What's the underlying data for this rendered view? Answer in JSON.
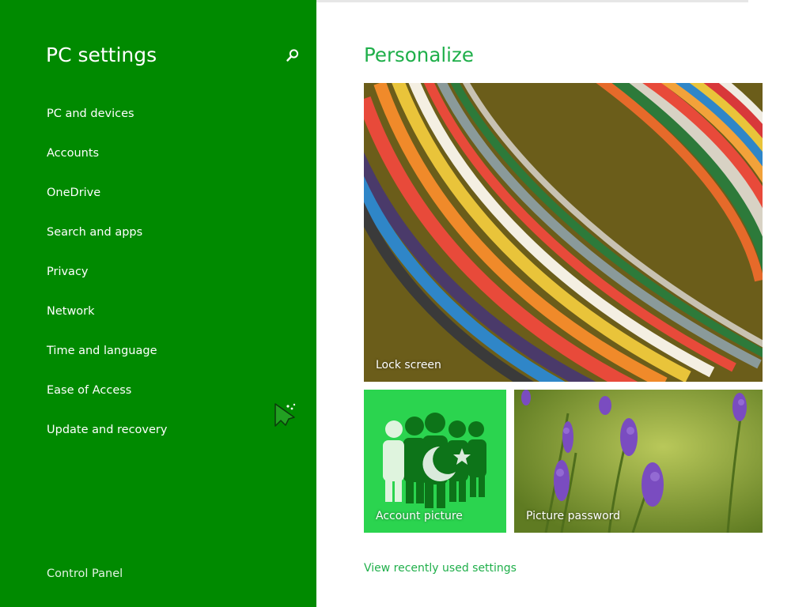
{
  "sidebar": {
    "title": "PC settings",
    "search_icon": "search-icon",
    "items": [
      {
        "label": "PC and devices"
      },
      {
        "label": "Accounts"
      },
      {
        "label": "OneDrive"
      },
      {
        "label": "Search and apps"
      },
      {
        "label": "Privacy"
      },
      {
        "label": "Network"
      },
      {
        "label": "Time and language"
      },
      {
        "label": "Ease of Access"
      },
      {
        "label": "Update and recovery"
      }
    ],
    "footer_link": "Control Panel"
  },
  "main": {
    "title": "Personalize",
    "tiles": [
      {
        "label": "Lock screen"
      },
      {
        "label": "Account picture"
      },
      {
        "label": "Picture password"
      }
    ],
    "recent_link": "View recently used settings"
  },
  "colors": {
    "sidebar_bg": "#008a00",
    "accent_text": "#1faf4a",
    "account_tile_bg": "#2bd44f"
  }
}
